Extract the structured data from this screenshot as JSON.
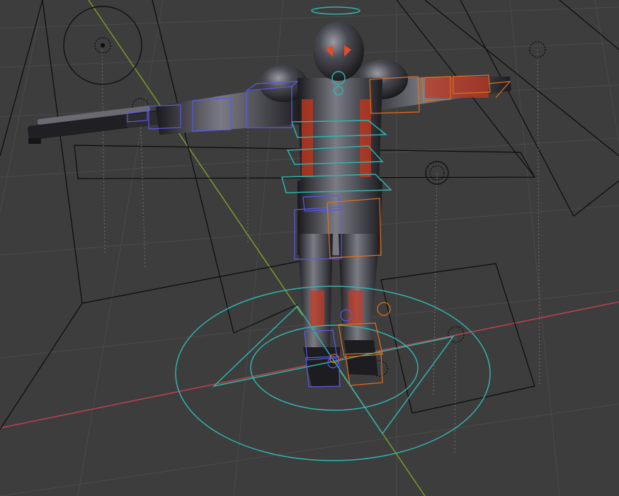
{
  "viewport": {
    "mode": "pose",
    "grid_color": "#4a4a4a",
    "background_color": "#3d3d3d",
    "axis_x_color": "#b8434c",
    "axis_y_color": "#7a9a2a"
  },
  "colors": {
    "rig_cyan": "#2fb3ad",
    "bone_left_blue": "#5959e8",
    "bone_right_orange": "#e0701f",
    "wire_black": "#0b0b0b",
    "armor_red": "#c8361e",
    "armor_dark": "#222226"
  },
  "scene_objects": [
    {
      "name": "character-rig",
      "icon": "armature-icon"
    },
    {
      "name": "rifle",
      "icon": "mesh-icon"
    },
    {
      "name": "camera",
      "icon": "camera-icon"
    },
    {
      "name": "empty-target",
      "icon": "empty-icon"
    }
  ]
}
